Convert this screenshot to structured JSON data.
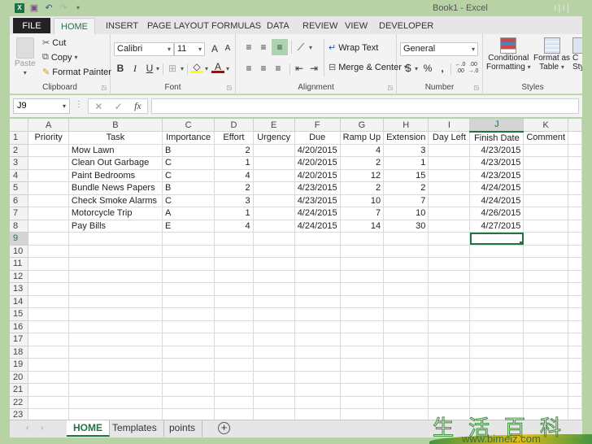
{
  "window": {
    "title": "Book1 - Excel",
    "controls_glyph": "ı|ı|"
  },
  "quick_access": [
    {
      "name": "excel-logo-icon",
      "glyph": "X"
    },
    {
      "name": "save-icon",
      "glyph": "▣"
    },
    {
      "name": "undo-icon",
      "glyph": "↶"
    },
    {
      "name": "redo-icon",
      "glyph": "↷"
    },
    {
      "name": "customize-qat-icon",
      "glyph": "▾"
    }
  ],
  "ribbon_tabs": [
    {
      "label": "FILE"
    },
    {
      "label": "HOME",
      "active": true
    },
    {
      "label": "INSERT"
    },
    {
      "label": "PAGE LAYOUT"
    },
    {
      "label": "FORMULAS"
    },
    {
      "label": "DATA"
    },
    {
      "label": "REVIEW"
    },
    {
      "label": "VIEW"
    },
    {
      "label": "DEVELOPER"
    }
  ],
  "clipboard": {
    "label": "Clipboard",
    "paste": "Paste",
    "cut": "Cut",
    "copy": "Copy",
    "format_painter": "Format Painter"
  },
  "font": {
    "label": "Font",
    "font_name": "Calibri",
    "font_size": "11",
    "grow": "A",
    "shrink": "A",
    "bold": "B",
    "italic": "I",
    "underline": "U",
    "font_color_letter": "A",
    "fill_color": "#ffff00",
    "font_color": "#c00000"
  },
  "alignment": {
    "label": "Alignment",
    "wrap_text": "Wrap Text",
    "merge_center": "Merge & Center"
  },
  "number": {
    "label": "Number",
    "format": "General",
    "currency": "$",
    "percent": "%",
    "comma": ",",
    "inc_decimal": "←.0 .00",
    "dec_decimal": ".00 →.0"
  },
  "styles": {
    "label": "Styles",
    "conditional_formatting_1": "Conditional",
    "conditional_formatting_2": "Formatting",
    "format_as_table_1": "Format as",
    "format_as_table_2": "Table",
    "cell_styles_1": "C",
    "cell_styles_2": "Styl"
  },
  "formula_bar": {
    "name_box": "J9",
    "cancel": "✕",
    "enter": "✓",
    "fx": "fx",
    "formula": ""
  },
  "sheet": {
    "columns": [
      "A",
      "B",
      "C",
      "D",
      "E",
      "F",
      "G",
      "H",
      "I",
      "J",
      "K"
    ],
    "selected_column": "J",
    "selected_row": 9,
    "headers": [
      "Priority",
      "Task",
      "Importance",
      "Effort",
      "Urgency",
      "Due",
      "Ramp Up",
      "Extension",
      "Day Left",
      "Finish Date",
      "Comment"
    ],
    "rows": [
      [
        "",
        "Mow Lawn",
        "B",
        "2",
        "",
        "4/20/2015",
        "4",
        "3",
        "",
        "4/23/2015",
        ""
      ],
      [
        "",
        "Clean Out Garbage",
        "C",
        "1",
        "",
        "4/20/2015",
        "2",
        "1",
        "",
        "4/23/2015",
        ""
      ],
      [
        "",
        "Paint Bedrooms",
        "C",
        "4",
        "",
        "4/20/2015",
        "12",
        "15",
        "",
        "4/23/2015",
        ""
      ],
      [
        "",
        "Bundle News Papers",
        "B",
        "2",
        "",
        "4/23/2015",
        "2",
        "2",
        "",
        "4/24/2015",
        ""
      ],
      [
        "",
        "Check Smoke Alarms",
        "C",
        "3",
        "",
        "4/23/2015",
        "10",
        "7",
        "",
        "4/24/2015",
        ""
      ],
      [
        "",
        "Motorcycle Trip",
        "A",
        "1",
        "",
        "4/24/2015",
        "7",
        "10",
        "",
        "4/26/2015",
        ""
      ],
      [
        "",
        "Pay Bills",
        "E",
        "4",
        "",
        "4/24/2015",
        "14",
        "30",
        "",
        "4/27/2015",
        ""
      ]
    ],
    "total_rows_visible": 23
  },
  "sheet_tabs": [
    {
      "label": "HOME",
      "active": true
    },
    {
      "label": "Templates"
    },
    {
      "label": "points"
    }
  ],
  "sheet_nav": {
    "prev": "‹",
    "next": "›",
    "add": "+"
  },
  "watermark": {
    "chars": "生活百科",
    "url": "www.bimeiz.com"
  }
}
